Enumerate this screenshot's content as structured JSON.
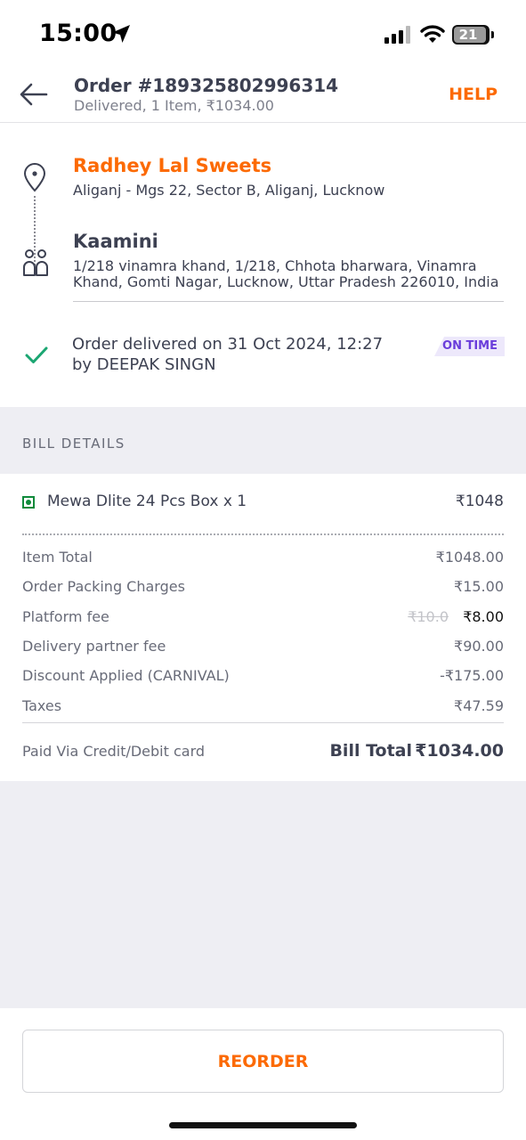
{
  "status_bar": {
    "time": "15:00",
    "battery": "21",
    "icons": [
      "location-arrow-icon",
      "signal-icon",
      "wifi-icon",
      "battery-icon"
    ]
  },
  "header": {
    "title": "Order #189325802996314",
    "subtitle": "Delivered, 1 Item, ₹1034.00",
    "help_label": "HELP",
    "back_icon": "back-arrow-icon"
  },
  "route": {
    "restaurant_name": "Radhey Lal Sweets",
    "restaurant_address": "Aliganj - Mgs 22, Sector B, Aliganj, Lucknow",
    "customer_name": "Kaamini",
    "customer_address": "1/218 vinamra khand, 1/218, Chhota bharwara, Vinamra Khand, Gomti Nagar, Lucknow, Uttar Pradesh 226010, India"
  },
  "delivery": {
    "line1": "Order delivered on 31 Oct 2024, 12:27",
    "line2": "by DEEPAK SINGN",
    "badge": "ON TIME"
  },
  "bill": {
    "section_title": "BILL DETAILS",
    "item": {
      "name": "Mewa Dlite 24 Pcs Box x 1",
      "price": "₹1048"
    },
    "rows": [
      {
        "label": "Item Total",
        "value": "₹1048.00"
      },
      {
        "label": "Order Packing Charges",
        "value": "₹15.00"
      },
      {
        "label": "Platform fee",
        "original": "₹10.0",
        "value": "₹8.00"
      },
      {
        "label": "Delivery partner fee",
        "value": "₹90.00"
      },
      {
        "label": "Discount Applied (CARNIVAL)",
        "value": "-₹175.00"
      },
      {
        "label": "Taxes",
        "value": "₹47.59"
      }
    ],
    "paid_via": "Paid Via Credit/Debit card",
    "total_label": "Bill Total",
    "total_value": "₹1034.00"
  },
  "actions": {
    "reorder_label": "REORDER"
  },
  "colors": {
    "accent": "#fc6a03",
    "text_dark": "#3d4152",
    "text_muted": "#686b78",
    "veg_green": "#0f8a3b",
    "check_green": "#1ba672",
    "ontime_purple": "#6a3ddb"
  }
}
